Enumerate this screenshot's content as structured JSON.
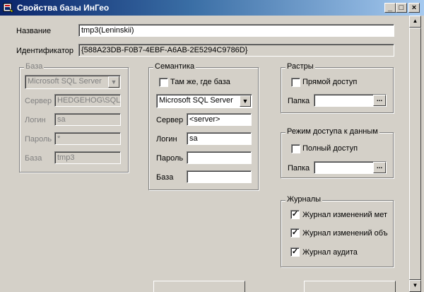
{
  "window": {
    "title": "Свойства базы ИнГео",
    "minimize": "_",
    "maximize": "□",
    "close": "×"
  },
  "name_label": "Название",
  "name_value": "tmp3(Leninskii)",
  "id_label": "Идентификатор",
  "id_value": "{588A23DB-F0B7-4EBF-A6AB-2E5294C9786D}",
  "baza": {
    "title": "База",
    "provider": "Microsoft SQL Server",
    "server_label": "Сервер",
    "server_value": "HEDGEHOG\\SQLEX",
    "login_label": "Логин",
    "login_value": "sa",
    "password_label": "Пароль",
    "password_value": "*",
    "db_label": "База",
    "db_value": "tmp3"
  },
  "semantika": {
    "title": "Семантика",
    "same_label": "Там же, где база",
    "provider": "Microsoft SQL Server",
    "server_label": "Сервер",
    "server_value": "<server>",
    "login_label": "Логин",
    "login_value": "sa",
    "password_label": "Пароль",
    "password_value": "",
    "db_label": "База",
    "db_value": ""
  },
  "rastry": {
    "title": "Растры",
    "direct_label": "Прямой доступ",
    "folder_label": "Папка",
    "folder_value": "",
    "browse": "..."
  },
  "access": {
    "title": "Режим доступа к данным",
    "full_label": "Полный доступ",
    "folder_label": "Папка",
    "folder_value": "",
    "browse": "..."
  },
  "journals": {
    "title": "Журналы",
    "items": [
      {
        "label": "Журнал изменений мет",
        "checked": "✓"
      },
      {
        "label": "Журнал изменений объ",
        "checked": "✓"
      },
      {
        "label": "Журнал аудита",
        "checked": "✓"
      }
    ]
  },
  "scrollbar": {
    "up": "▲",
    "down": "▼"
  }
}
